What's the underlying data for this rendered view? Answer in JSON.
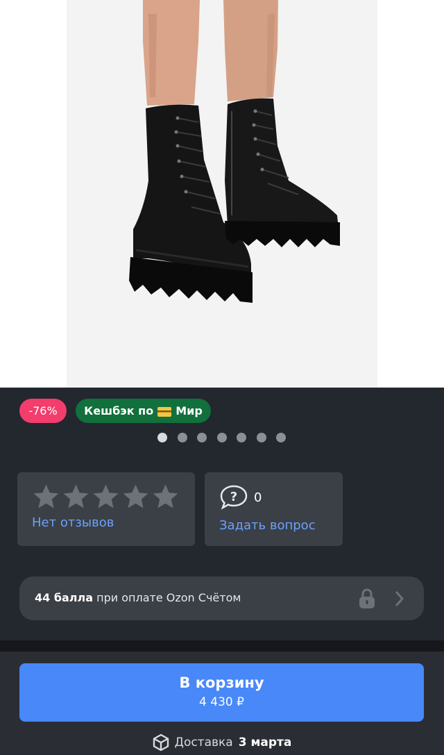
{
  "product_image": {
    "icon": "black-lace-up-boots-photo"
  },
  "badges": {
    "discount": {
      "label": "-76%",
      "color": "#f23d6d"
    },
    "cashback": {
      "label_prefix": "Кешбэк по",
      "card_icon": "credit-card-emoji",
      "label_suffix": "Мир",
      "color": "#11703c"
    }
  },
  "carousel": {
    "total_dots": 7,
    "active_index": 0
  },
  "rating": {
    "stars_filled": 0,
    "stars_total": 5,
    "reviews_label": "Нет отзывов",
    "star_color": "#6d7178"
  },
  "questions": {
    "icon": "question-bubble-icon",
    "count": "0",
    "ask_label": "Задать вопрос"
  },
  "points": {
    "bold": "44 балла",
    "text": "при оплате Ozon Счётом",
    "lock_icon": "lock-icon",
    "chevron_icon": "chevron-right-icon"
  },
  "cart": {
    "title": "В корзину",
    "price": "4 430 ₽",
    "color": "#4888f8"
  },
  "delivery": {
    "icon": "box-icon",
    "label": "Доставка",
    "date": "3 марта"
  },
  "colors": {
    "accent_link": "#6aa2ff",
    "background": "#23272e",
    "surface": "#3b3f46"
  }
}
